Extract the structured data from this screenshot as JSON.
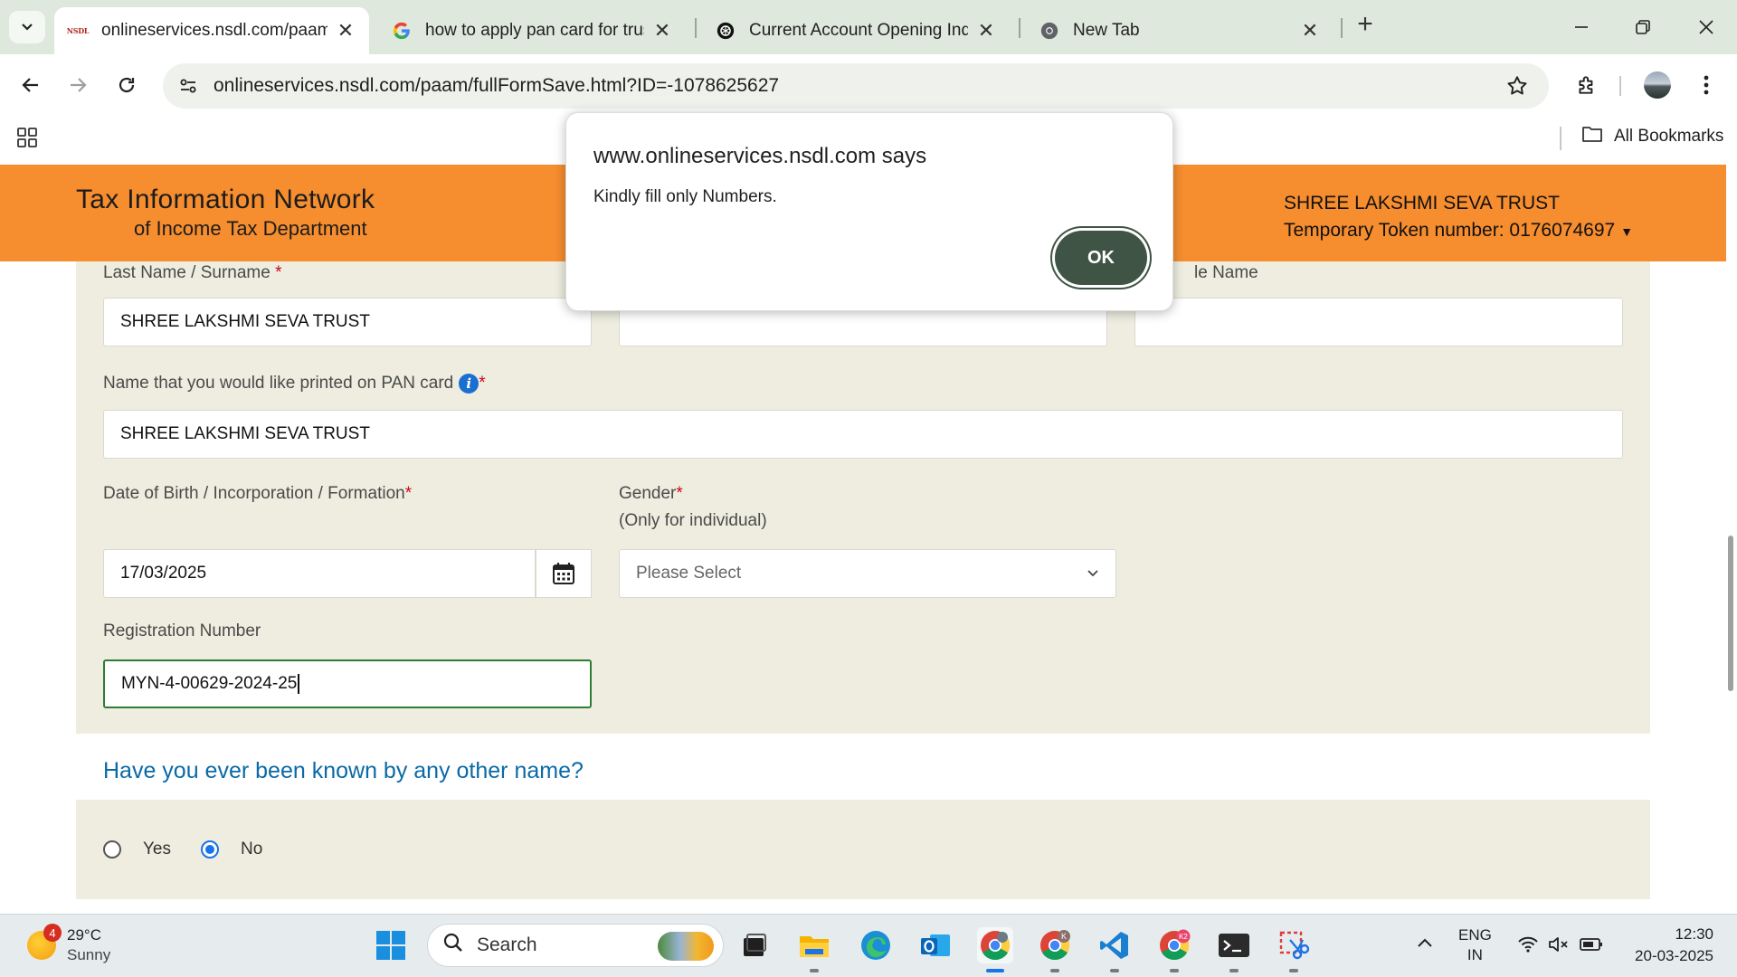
{
  "browser": {
    "tabs": [
      {
        "title": "onlineservices.nsdl.com/paam/f",
        "favicon": "nsdl-favicon",
        "active": true
      },
      {
        "title": "how to apply pan card for trust",
        "favicon": "google-favicon",
        "active": false
      },
      {
        "title": "Current Account Opening Inqui",
        "favicon": "chatgpt-favicon",
        "active": false
      },
      {
        "title": "New Tab",
        "favicon": "chrome-favicon",
        "active": false
      }
    ],
    "url": "onlineservices.nsdl.com/paam/fullFormSave.html?ID=-1078625627",
    "bookmarks_label": "All Bookmarks",
    "nsdl_favicon_text": "NSDL"
  },
  "site": {
    "logo_line1": "Tax Information Network",
    "logo_line2": "of Income Tax Department",
    "applicant_name": "SHREE LAKSHMI SEVA TRUST",
    "token_label": "Temporary Token number: 0176074697",
    "header_color": "#f68d2e"
  },
  "form": {
    "last_name_label": "Last Name / Surname",
    "last_name_value": "SHREE LAKSHMI SEVA TRUST",
    "middle_name_label_partial": "le Name",
    "required_mark": "*",
    "printed_name_label": "Name that you would like printed on PAN card",
    "printed_name_value": "SHREE LAKSHMI SEVA TRUST",
    "dob_label": "Date of Birth / Incorporation / Formation",
    "dob_value": "17/03/2025",
    "gender_label": "Gender",
    "gender_note": "(Only for individual)",
    "gender_placeholder": "Please Select",
    "reg_label": "Registration Number",
    "reg_value": "MYN-4-00629-2024-25",
    "other_name_question": "Have you ever been known by any other name?",
    "radio_yes": "Yes",
    "radio_no": "No",
    "selected_radio": "No"
  },
  "dialog": {
    "title": "www.onlineservices.nsdl.com says",
    "message": "Kindly fill only Numbers.",
    "ok_label": "OK"
  },
  "taskbar": {
    "weather_temp": "29°C",
    "weather_cond": "Sunny",
    "weather_badge": "4",
    "search_label": "Search",
    "lang_line1": "ENG",
    "lang_line2": "IN",
    "time": "12:30",
    "date": "20-03-2025",
    "chrome_profile_k": "K",
    "chrome_profile_k2": "K2"
  }
}
